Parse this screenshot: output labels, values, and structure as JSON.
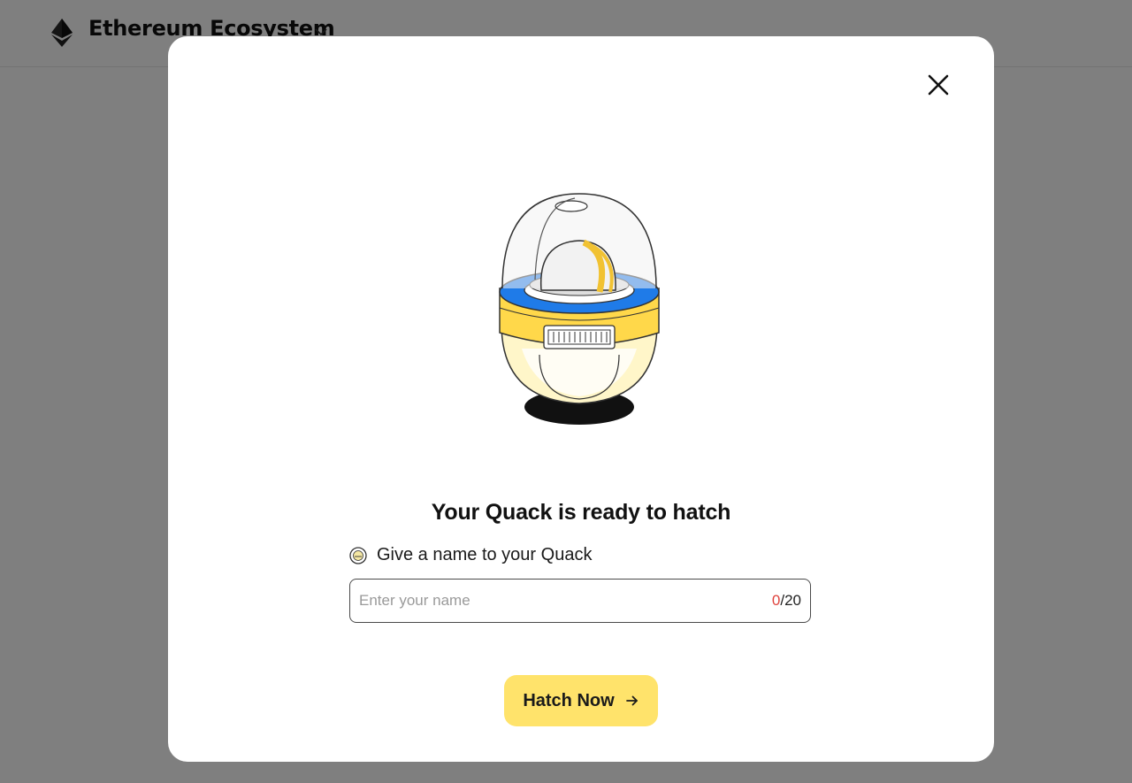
{
  "header": {
    "network_name": "Ethereum Ecosystem",
    "network_icon": "ethereum-icon",
    "dropdown_icon": "chevron-down-icon"
  },
  "modal": {
    "close_icon": "close-icon",
    "illustration": "egg-incubator",
    "title": "Your Quack is ready to hatch",
    "name_label_icon": "duck-icon",
    "name_label": "Give a name to your Quack",
    "name_input": {
      "value": "",
      "placeholder": "Enter your name",
      "char_count": "0",
      "char_limit": "/20"
    },
    "hatch_button": {
      "label": "Hatch Now",
      "icon": "arrow-right-icon"
    }
  },
  "colors": {
    "accent_yellow": "#ffe36b",
    "counter_red": "#e0443e",
    "incubator_blue": "#1f7be8"
  }
}
